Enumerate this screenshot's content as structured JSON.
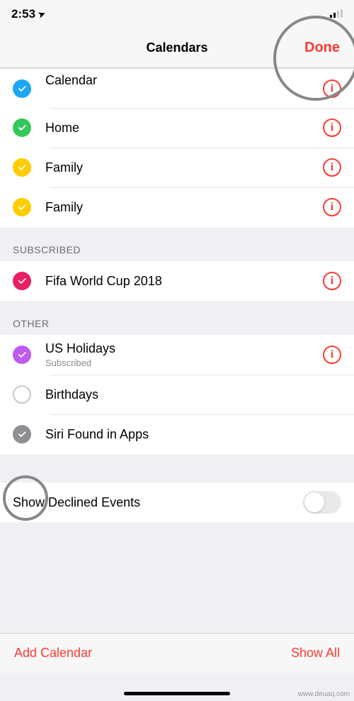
{
  "status": {
    "time": "2:53",
    "locationGlyph": "➤"
  },
  "nav": {
    "title": "Calendars",
    "done": "Done"
  },
  "groups": [
    {
      "items": [
        {
          "name": "calendar-row-calendar",
          "color": "#1ca7f5",
          "label": "Calendar",
          "checked": true,
          "info": true
        },
        {
          "name": "calendar-row-home",
          "color": "#34c759",
          "label": "Home",
          "checked": true,
          "info": true
        },
        {
          "name": "calendar-row-family-1",
          "color": "#ffcc00",
          "label": "Family",
          "checked": true,
          "info": true
        },
        {
          "name": "calendar-row-family-2",
          "color": "#ffcc00",
          "label": "Family",
          "checked": true,
          "info": true
        }
      ]
    },
    {
      "header": "SUBSCRIBED",
      "items": [
        {
          "name": "calendar-row-worldcup",
          "color": "#e91e63",
          "label": "Fifa World Cup 2018",
          "checked": true,
          "info": true
        }
      ]
    },
    {
      "header": "OTHER",
      "items": [
        {
          "name": "calendar-row-us-holidays",
          "color": "#bf5af2",
          "label": "US Holidays",
          "sublabel": "Subscribed",
          "checked": true,
          "info": true
        },
        {
          "name": "calendar-row-birthdays",
          "color": "#ff3b30",
          "label": "Birthdays",
          "checked": false,
          "info": false
        },
        {
          "name": "calendar-row-siri",
          "color": "#8e8e93",
          "label": "Siri Found in Apps",
          "checked": true,
          "info": false
        }
      ]
    }
  ],
  "toggle": {
    "label": "Show Declined Events",
    "on": false
  },
  "footer": {
    "add": "Add Calendar",
    "showAll": "Show All"
  },
  "watermark": "www.deuaq.com"
}
